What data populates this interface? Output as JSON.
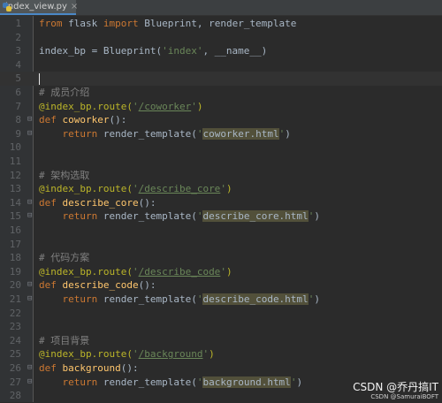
{
  "tab": {
    "title": "index_view.py",
    "close": "×",
    "icon": "python-file-icon"
  },
  "lines": [
    {
      "n": "1",
      "fold": "",
      "tokens": [
        {
          "t": "from",
          "c": "kw"
        },
        {
          "t": " flask ",
          "c": ""
        },
        {
          "t": "import",
          "c": "kw"
        },
        {
          "t": " Blueprint, render_template",
          "c": ""
        }
      ]
    },
    {
      "n": "2",
      "fold": "",
      "tokens": []
    },
    {
      "n": "3",
      "fold": "",
      "tokens": [
        {
          "t": "index_bp = Blueprint(",
          "c": ""
        },
        {
          "t": "'index'",
          "c": "str"
        },
        {
          "t": ", __name__)",
          "c": ""
        }
      ]
    },
    {
      "n": "4",
      "fold": "",
      "tokens": []
    },
    {
      "n": "5",
      "fold": "",
      "cursor": true,
      "tokens": []
    },
    {
      "n": "6",
      "fold": "",
      "tokens": [
        {
          "t": "# 成员介绍",
          "c": "cm"
        }
      ]
    },
    {
      "n": "7",
      "fold": "",
      "tokens": [
        {
          "t": "@index_bp.route(",
          "c": "dec"
        },
        {
          "t": "'",
          "c": "str"
        },
        {
          "t": "/coworker",
          "c": "url"
        },
        {
          "t": "'",
          "c": "str"
        },
        {
          "t": ")",
          "c": "dec"
        }
      ]
    },
    {
      "n": "8",
      "fold": "⊟",
      "tokens": [
        {
          "t": "def ",
          "c": "kw"
        },
        {
          "t": "coworker",
          "c": "fn"
        },
        {
          "t": "():",
          "c": ""
        }
      ]
    },
    {
      "n": "9",
      "fold": "⊟",
      "tokens": [
        {
          "t": "    ",
          "c": ""
        },
        {
          "t": "return",
          "c": "kw"
        },
        {
          "t": " render_template(",
          "c": ""
        },
        {
          "t": "'",
          "c": "str"
        },
        {
          "t": "coworker.html",
          "c": "hl"
        },
        {
          "t": "'",
          "c": "str"
        },
        {
          "t": ")",
          "c": ""
        }
      ]
    },
    {
      "n": "10",
      "fold": "",
      "tokens": []
    },
    {
      "n": "11",
      "fold": "",
      "tokens": []
    },
    {
      "n": "12",
      "fold": "",
      "tokens": [
        {
          "t": "# 架构选取",
          "c": "cm"
        }
      ]
    },
    {
      "n": "13",
      "fold": "",
      "tokens": [
        {
          "t": "@index_bp.route(",
          "c": "dec"
        },
        {
          "t": "'",
          "c": "str"
        },
        {
          "t": "/describe_core",
          "c": "url"
        },
        {
          "t": "'",
          "c": "str"
        },
        {
          "t": ")",
          "c": "dec"
        }
      ]
    },
    {
      "n": "14",
      "fold": "⊟",
      "tokens": [
        {
          "t": "def ",
          "c": "kw"
        },
        {
          "t": "describe_core",
          "c": "fn"
        },
        {
          "t": "():",
          "c": ""
        }
      ]
    },
    {
      "n": "15",
      "fold": "⊟",
      "tokens": [
        {
          "t": "    ",
          "c": ""
        },
        {
          "t": "return",
          "c": "kw"
        },
        {
          "t": " render_template(",
          "c": ""
        },
        {
          "t": "'",
          "c": "str"
        },
        {
          "t": "describe_core.html",
          "c": "hl"
        },
        {
          "t": "'",
          "c": "str"
        },
        {
          "t": ")",
          "c": ""
        }
      ]
    },
    {
      "n": "16",
      "fold": "",
      "tokens": []
    },
    {
      "n": "17",
      "fold": "",
      "tokens": []
    },
    {
      "n": "18",
      "fold": "",
      "tokens": [
        {
          "t": "# 代码方案",
          "c": "cm"
        }
      ]
    },
    {
      "n": "19",
      "fold": "",
      "tokens": [
        {
          "t": "@index_bp.route(",
          "c": "dec"
        },
        {
          "t": "'",
          "c": "str"
        },
        {
          "t": "/describe_code",
          "c": "url"
        },
        {
          "t": "'",
          "c": "str"
        },
        {
          "t": ")",
          "c": "dec"
        }
      ]
    },
    {
      "n": "20",
      "fold": "⊟",
      "tokens": [
        {
          "t": "def ",
          "c": "kw"
        },
        {
          "t": "describe_code",
          "c": "fn"
        },
        {
          "t": "():",
          "c": ""
        }
      ]
    },
    {
      "n": "21",
      "fold": "⊟",
      "tokens": [
        {
          "t": "    ",
          "c": ""
        },
        {
          "t": "return",
          "c": "kw"
        },
        {
          "t": " render_template(",
          "c": ""
        },
        {
          "t": "'",
          "c": "str"
        },
        {
          "t": "describe_code.html",
          "c": "hl"
        },
        {
          "t": "'",
          "c": "str"
        },
        {
          "t": ")",
          "c": ""
        }
      ]
    },
    {
      "n": "22",
      "fold": "",
      "tokens": []
    },
    {
      "n": "23",
      "fold": "",
      "tokens": []
    },
    {
      "n": "24",
      "fold": "",
      "tokens": [
        {
          "t": "# 项目背景",
          "c": "cm"
        }
      ]
    },
    {
      "n": "25",
      "fold": "",
      "tokens": [
        {
          "t": "@index_bp.route(",
          "c": "dec"
        },
        {
          "t": "'",
          "c": "str"
        },
        {
          "t": "/background",
          "c": "url"
        },
        {
          "t": "'",
          "c": "str"
        },
        {
          "t": ")",
          "c": "dec"
        }
      ]
    },
    {
      "n": "26",
      "fold": "⊟",
      "tokens": [
        {
          "t": "def ",
          "c": "kw"
        },
        {
          "t": "background",
          "c": "fn"
        },
        {
          "t": "():",
          "c": ""
        }
      ]
    },
    {
      "n": "27",
      "fold": "⊟",
      "tokens": [
        {
          "t": "    ",
          "c": ""
        },
        {
          "t": "return",
          "c": "kw"
        },
        {
          "t": " render_template(",
          "c": ""
        },
        {
          "t": "'",
          "c": "str"
        },
        {
          "t": "background.html",
          "c": "hl"
        },
        {
          "t": "'",
          "c": "str"
        },
        {
          "t": ")",
          "c": ""
        }
      ]
    },
    {
      "n": "28",
      "fold": "",
      "tokens": []
    }
  ],
  "watermark": {
    "main": "CSDN @乔丹搞IT",
    "sub": "CSDN @SamuraiBOFT"
  },
  "colors": {
    "background": "#2b2b2b",
    "keyword": "#cc7832",
    "string": "#6a8759",
    "comment": "#808080",
    "decorator": "#bbb529",
    "function": "#ffc66d",
    "text": "#a9b7c6"
  }
}
